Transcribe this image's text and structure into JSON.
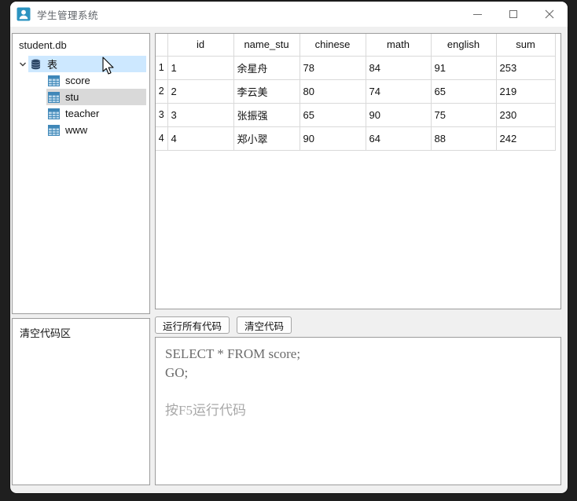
{
  "window": {
    "title": "学生管理系统"
  },
  "sidebar": {
    "db_name": "student.db",
    "tree_root_label": "表",
    "tables": [
      {
        "label": "score"
      },
      {
        "label": "stu"
      },
      {
        "label": "teacher"
      },
      {
        "label": "www"
      }
    ],
    "selected_table": "stu"
  },
  "results_table": {
    "columns": [
      "id",
      "name_stu",
      "chinese",
      "math",
      "english",
      "sum"
    ],
    "rows": [
      {
        "num": "1",
        "cells": [
          "1",
          "余星舟",
          "78",
          "84",
          "91",
          "253"
        ]
      },
      {
        "num": "2",
        "cells": [
          "2",
          "李云美",
          "80",
          "74",
          "65",
          "219"
        ]
      },
      {
        "num": "3",
        "cells": [
          "3",
          "张振强",
          "65",
          "90",
          "75",
          "230"
        ]
      },
      {
        "num": "4",
        "cells": [
          "4",
          "郑小翠",
          "90",
          "64",
          "88",
          "242"
        ]
      }
    ]
  },
  "codezone": {
    "label": "清空代码区"
  },
  "toolbar": {
    "run_all_label": "运行所有代码",
    "clear_label": "清空代码"
  },
  "code_editor": {
    "line1": "SELECT * FROM score;",
    "line2": "GO;",
    "hint": "按F5运行代码"
  },
  "icons": {
    "app": "user-icon",
    "tree_root": "database-icon",
    "tree_table": "table-grid-icon",
    "minimize": "minimize-icon",
    "maximize": "maximize-icon",
    "close": "close-icon"
  },
  "colors": {
    "accent_blue": "#2b93c0",
    "tree_hover": "#cde8ff",
    "tree_selected": "#d9d9d9",
    "grid_line": "#d9d9d9",
    "window_bg": "#f0f0f0",
    "backdrop": "#1f1f1f"
  }
}
